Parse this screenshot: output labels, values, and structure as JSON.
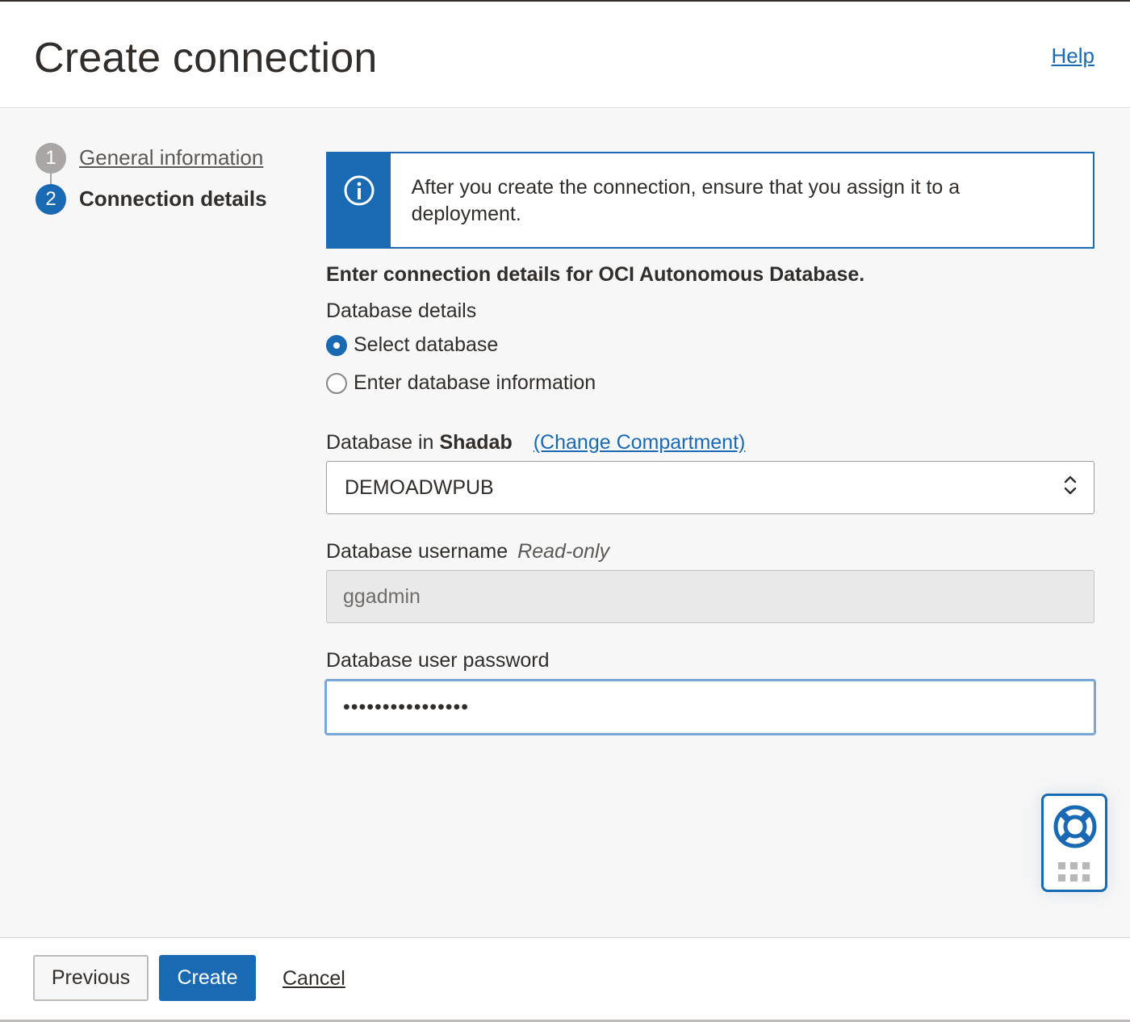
{
  "header": {
    "title": "Create connection",
    "help_label": "Help"
  },
  "steps": [
    {
      "number": "1",
      "label": "General information",
      "state": "completed"
    },
    {
      "number": "2",
      "label": "Connection details",
      "state": "current"
    }
  ],
  "info_banner": {
    "icon": "info-icon",
    "text": "After you create the connection, ensure that you assign it to a deployment."
  },
  "form": {
    "section_title": "Enter connection details for OCI Autonomous Database.",
    "database_details_label": "Database details",
    "radio_options": [
      {
        "label": "Select database",
        "checked": true
      },
      {
        "label": "Enter database information",
        "checked": false
      }
    ],
    "database_label_prefix": "Database in",
    "compartment_name": "Shadab",
    "change_compartment_label": "(Change Compartment)",
    "database_selected": "DEMOADWPUB",
    "username_label": "Database username",
    "username_readonly_tag": "Read-only",
    "username_value": "ggadmin",
    "password_label": "Database user password",
    "password_value": "••••••••••••••••"
  },
  "support_widget": {
    "icon": "lifebuoy-icon"
  },
  "footer": {
    "previous_label": "Previous",
    "create_label": "Create",
    "cancel_label": "Cancel"
  },
  "colors": {
    "accent": "#1a6ab3",
    "text": "#312d2a",
    "background": "#f7f7f7"
  }
}
